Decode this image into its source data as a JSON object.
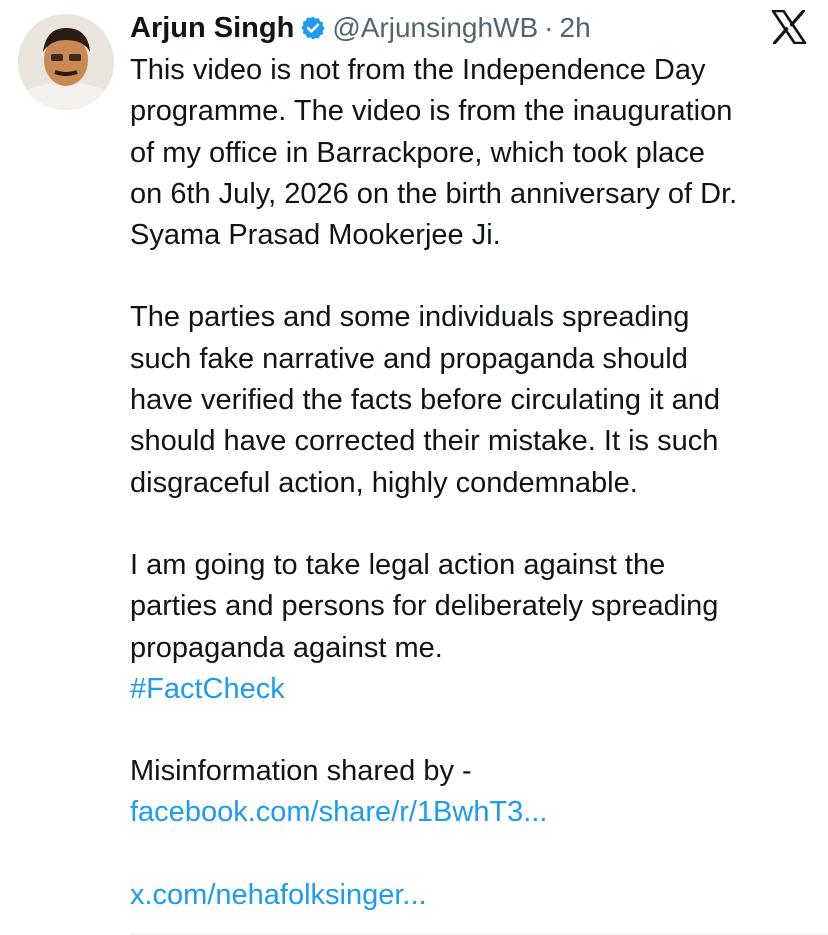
{
  "author": {
    "name": "Arjun Singh",
    "handle": "@ArjunsinghWB",
    "separator": "·",
    "time": "2h",
    "verified": true,
    "avatar_icon": "profile-photo"
  },
  "platform_icon": "x-logo-icon",
  "tweet": {
    "para1_lines": [
      "This video is not from the Independence Day",
      "programme. The video is from the inauguration",
      "of my office in Barrackpore, which took place",
      "on 6th July, 2026 on the birth anniversary of Dr.",
      "Syama Prasad Mookerjee Ji."
    ],
    "para2_lines": [
      "The parties and some individuals spreading",
      "such fake narrative and propaganda should",
      "have verified the facts before circulating it and",
      "should have corrected their mistake. It is such",
      "disgraceful action, highly condemnable."
    ],
    "para3_lines": [
      "I am going to take legal action against the",
      "parties and persons for deliberately spreading",
      "propaganda against me."
    ],
    "hashtag": "#FactCheck",
    "misinfo_label": "Misinformation shared by -",
    "link1": "facebook.com/share/r/1BwhT3...",
    "link2": "x.com/nehafolksinger..."
  },
  "colors": {
    "text": "#0f1419",
    "secondary": "#536471",
    "link": "#1d9bf0",
    "verified_badge": "#1d9bf0"
  }
}
